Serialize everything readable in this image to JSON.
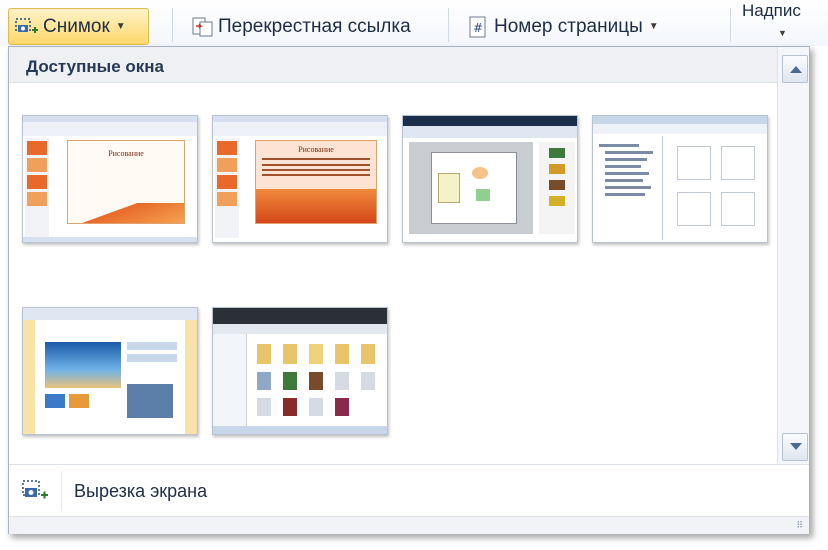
{
  "ribbon": {
    "screenshot_label": "Снимок",
    "crossref_label": "Перекрестная ссылка",
    "pagenum_label": "Номер страницы",
    "caption_label": "Надпис"
  },
  "panel": {
    "header": "Доступные окна",
    "clip_label": "Вырезка экрана",
    "thumbnails": [
      {
        "title": "Рисование"
      },
      {
        "title": "Рисование"
      },
      {
        "title": ""
      },
      {
        "title": ""
      },
      {
        "title": ""
      },
      {
        "title": ""
      }
    ]
  },
  "colors": {
    "accent": "#ffd86c",
    "ppt_orange": "#e8692a"
  }
}
